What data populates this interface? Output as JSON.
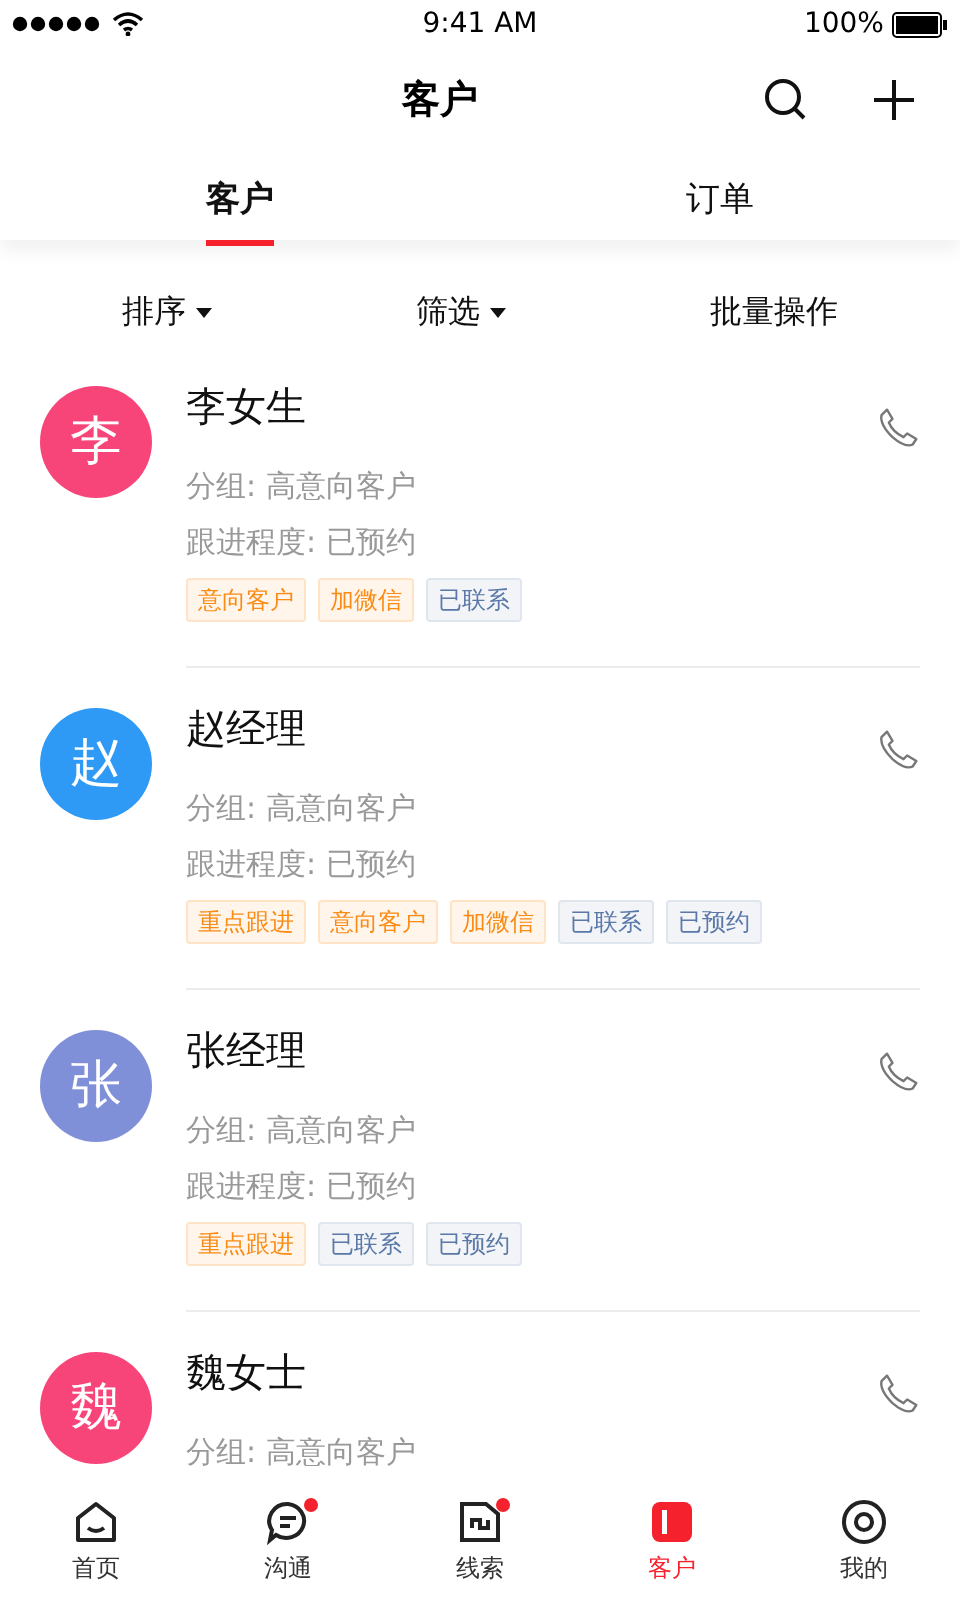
{
  "status_bar": {
    "time": "9:41 AM",
    "battery": "100%"
  },
  "nav": {
    "title": "客户"
  },
  "tabs": [
    {
      "label": "客户",
      "selected": true
    },
    {
      "label": "订单",
      "selected": false
    }
  ],
  "filters": [
    {
      "label": "排序",
      "dropdown": true
    },
    {
      "label": "筛选",
      "dropdown": true
    },
    {
      "label": "批量操作",
      "dropdown": false
    }
  ],
  "customers": [
    {
      "avatar": "李",
      "color": "#f7457a",
      "name": "李女生",
      "group": "分组: 高意向客户",
      "progress": "跟进程度: 已预约",
      "tags": [
        {
          "label": "意向客户",
          "kind": "warm"
        },
        {
          "label": "加微信",
          "kind": "warm"
        },
        {
          "label": "已联系",
          "kind": "cool"
        }
      ]
    },
    {
      "avatar": "赵",
      "color": "#2f9af5",
      "name": "赵经理",
      "group": "分组: 高意向客户",
      "progress": "跟进程度: 已预约",
      "tags": [
        {
          "label": "重点跟进",
          "kind": "warm"
        },
        {
          "label": "意向客户",
          "kind": "warm"
        },
        {
          "label": "加微信",
          "kind": "warm"
        },
        {
          "label": "已联系",
          "kind": "cool"
        },
        {
          "label": "已预约",
          "kind": "cool"
        }
      ]
    },
    {
      "avatar": "张",
      "color": "#7f8fd8",
      "name": "张经理",
      "group": "分组: 高意向客户",
      "progress": "跟进程度: 已预约",
      "tags": [
        {
          "label": "重点跟进",
          "kind": "warm"
        },
        {
          "label": "已联系",
          "kind": "cool"
        },
        {
          "label": "已预约",
          "kind": "cool"
        }
      ]
    },
    {
      "avatar": "魏",
      "color": "#f7457a",
      "name": "魏女士",
      "group": "分组: 高意向客户"
    }
  ],
  "tab_bar": [
    {
      "label": "首页",
      "selected": false,
      "badge": false
    },
    {
      "label": "沟通",
      "selected": false,
      "badge": true
    },
    {
      "label": "线索",
      "selected": false,
      "badge": true
    },
    {
      "label": "客户",
      "selected": true,
      "badge": false
    },
    {
      "label": "我的",
      "selected": false,
      "badge": false
    }
  ]
}
